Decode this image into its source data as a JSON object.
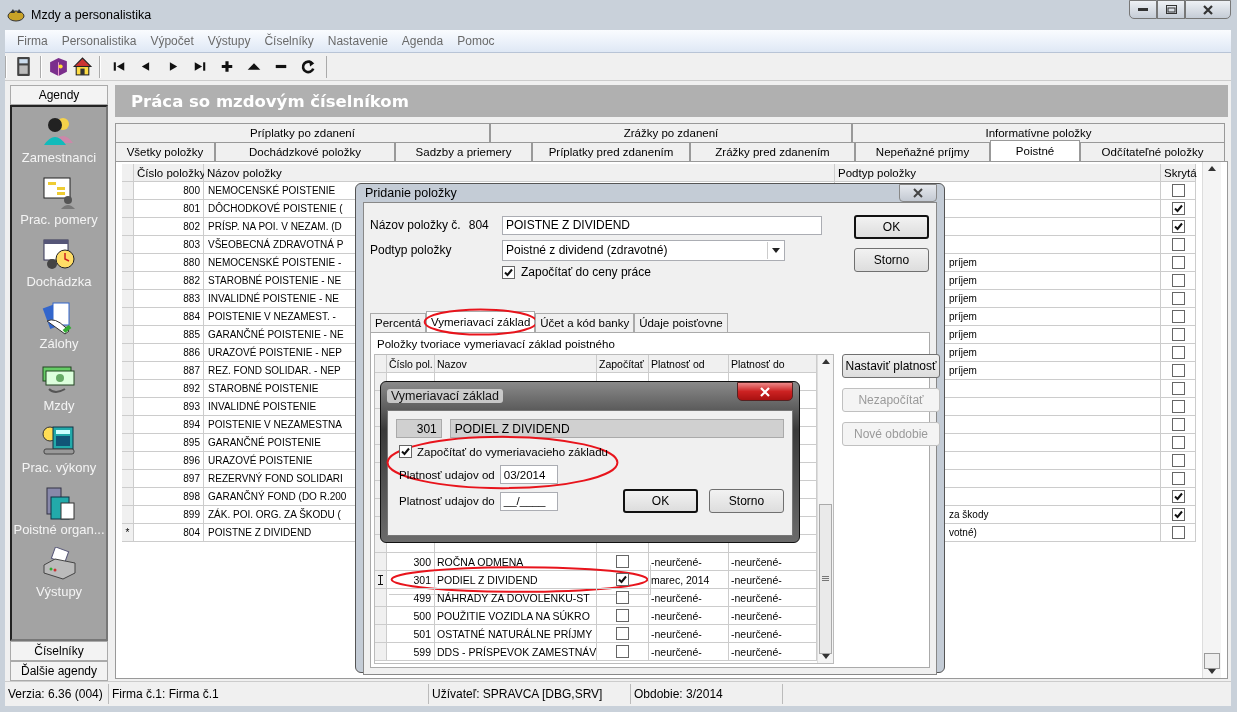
{
  "window": {
    "title": "Mzdy a personalistika"
  },
  "menu": [
    "Firma",
    "Personalistika",
    "Výpočet",
    "Výstupy",
    "Číselníky",
    "Nastavenie",
    "Agenda",
    "Pomoc"
  ],
  "sidebar": {
    "header": "Agendy",
    "items": [
      {
        "label": "Zamestnanci"
      },
      {
        "label": "Prac. pomery"
      },
      {
        "label": "Dochádzka"
      },
      {
        "label": "Zálohy"
      },
      {
        "label": "Mzdy"
      },
      {
        "label": "Prac. výkony"
      },
      {
        "label": "Poistné organ..."
      },
      {
        "label": "Výstupy"
      }
    ],
    "footer_buttons": [
      "Číselníky",
      "Ďalšie agendy"
    ]
  },
  "page_title": "Práca so mzdovým číselníkom",
  "tabs": {
    "row_1": [
      {
        "label": "Príplatky po zdanení",
        "selected": false
      },
      {
        "label": "Zrážky po zdanení",
        "selected": false
      },
      {
        "label": "Informatívne položky",
        "selected": false
      }
    ],
    "row_2": [
      {
        "label": "Všetky položky",
        "selected": false
      },
      {
        "label": "Dochádzkové položky",
        "selected": false
      },
      {
        "label": "Sadzby a priemery",
        "selected": false
      },
      {
        "label": "Príplatky pred zdanením",
        "selected": false
      },
      {
        "label": "Zrážky pred zdanením",
        "selected": false
      },
      {
        "label": "Nepeňažné príjmy",
        "selected": false
      },
      {
        "label": "Poistné",
        "selected": true
      },
      {
        "label": "Odčítateľné položky",
        "selected": false
      }
    ]
  },
  "table": {
    "columns": [
      "Číslo položky",
      "Názov položky",
      "Podtyp položky",
      "Skrytá"
    ],
    "rows": [
      {
        "number": "800",
        "name": "NEMOCENSKÉ POISTENIE",
        "hidden": false
      },
      {
        "number": "801",
        "name": "DÔCHODKOVÉ POISTENIE (",
        "hidden": true
      },
      {
        "number": "802",
        "name": "PRÍSP. NA POI. V NEZAM. (D",
        "hidden": true
      },
      {
        "number": "803",
        "name": "VŠEOBECNÁ ZDRAVOTNÁ P",
        "hidden": false
      },
      {
        "number": "880",
        "name": "NEMOCENSKÉ POISTENIE -",
        "subtype": "príjem",
        "hidden": false
      },
      {
        "number": "882",
        "name": "STAROBNÉ POISTENIE - NE",
        "subtype": "príjem",
        "hidden": false
      },
      {
        "number": "883",
        "name": "INVALIDNÉ POISTENIE - NE",
        "subtype": "príjem",
        "hidden": false
      },
      {
        "number": "884",
        "name": "POISTENIE V NEZAMEST. -",
        "subtype": "príjem",
        "hidden": false
      },
      {
        "number": "885",
        "name": "GARANČNÉ POISTENIE - NE",
        "subtype": "príjem",
        "hidden": false
      },
      {
        "number": "886",
        "name": "URAZOVÉ POISTENIE - NEP",
        "subtype": "príjem",
        "hidden": false
      },
      {
        "number": "887",
        "name": "REZ. FOND SOLIDAR. - NEP",
        "subtype": "príjem",
        "hidden": false
      },
      {
        "number": "892",
        "name": "STAROBNÉ POISTENIE",
        "hidden": false
      },
      {
        "number": "893",
        "name": "INVALIDNÉ POISTENIE",
        "hidden": false
      },
      {
        "number": "894",
        "name": "POISTENIE V NEZAMESTNA",
        "hidden": false
      },
      {
        "number": "895",
        "name": "GARANČNÉ POISTENIE",
        "hidden": false
      },
      {
        "number": "896",
        "name": "URAZOVÉ POISTENIE",
        "hidden": false
      },
      {
        "number": "897",
        "name": "REZERVNÝ FOND SOLIDARI",
        "hidden": false
      },
      {
        "number": "898",
        "name": "GARANČNÝ FOND (DO R.200",
        "hidden": true
      },
      {
        "number": "899",
        "name": "ZÁK. POI. ORG. ZA ŠKODU (",
        "subtype": "za škody",
        "hidden": true
      },
      {
        "marker": "*",
        "number": "804",
        "name": "POISTNE Z DIVIDEND",
        "subtype": "votné)",
        "hidden": false
      }
    ]
  },
  "dialog": {
    "title": "Pridanie položky",
    "name_label": "Názov položky č.",
    "number": "804",
    "name_value": "POISTNE Z DIVIDEND",
    "subtype_label": "Podtyp položky",
    "subtype_value": "Poistné z dividend (zdravotné)",
    "labor_cost": {
      "label": "Započítať do ceny práce",
      "checked": true
    },
    "ok": "OK",
    "cancel": "Storno",
    "tabs": [
      {
        "label": "Percentá",
        "selected": false,
        "highlighted": false
      },
      {
        "label": "Vymeriavací základ",
        "selected": true,
        "highlighted": true
      },
      {
        "label": "Účet a kód banky",
        "selected": false,
        "highlighted": false
      },
      {
        "label": "Údaje poisťovne",
        "selected": false,
        "highlighted": false
      }
    ],
    "panel_caption": "Položky tvoriace vymeriavací základ poistného",
    "grid": {
      "columns": [
        "Číslo pol.",
        "Nazov",
        "Započítať",
        "Platnosť od",
        "Platnosť do"
      ],
      "rows": [
        {
          "number": "300",
          "name": "ROČNA ODMENA",
          "included": false,
          "from": "-neurčené-",
          "to": "-neurčené-",
          "current": false,
          "highlighted": false
        },
        {
          "number": "301",
          "name": "PODIEL Z DIVIDEND",
          "included": true,
          "from": "marec, 2014",
          "to": "-neurčené-",
          "current": true,
          "highlighted": true
        },
        {
          "number": "499",
          "name": "NÁHRADY ZA DOVOLENKU-ST",
          "included": false,
          "from": "-neurčené-",
          "to": "-neurčené-",
          "current": false,
          "highlighted": false
        },
        {
          "number": "500",
          "name": "POUŽITIE VOZIDLA NA SÚKRO",
          "included": false,
          "from": "-neurčené-",
          "to": "-neurčené-",
          "current": false,
          "highlighted": false
        },
        {
          "number": "501",
          "name": "OSTATNÉ NATURÁLNE PRÍJMY",
          "included": false,
          "from": "-neurčené-",
          "to": "-neurčené-",
          "current": false,
          "highlighted": false
        },
        {
          "number": "599",
          "name": "DDS - PRÍSPEVOK ZAMESTNÁV",
          "included": false,
          "from": "-neurčené-",
          "to": "-neurčené-",
          "current": false,
          "highlighted": false
        }
      ]
    },
    "side_buttons": [
      {
        "label": "Nastaviť platnosť",
        "disabled": false
      },
      {
        "label": "Nezapočítať",
        "disabled": true
      },
      {
        "label": "Nové obdobie",
        "disabled": true
      }
    ]
  },
  "subdialog": {
    "title": "Vymeriavací základ",
    "number": "301",
    "name": "PODIEL Z DIVIDEND",
    "include": {
      "label": "Započítať do vymeriavacieho základu",
      "checked": true
    },
    "from_label": "Platnosť udajov od",
    "from_value": "03/2014",
    "to_label": "Platnosť udajov do",
    "to_value": "__/____",
    "highlighted": true,
    "ok": "OK",
    "cancel": "Storno"
  },
  "status_bar": [
    "Verzia: 6.36 (004)",
    "Firma č.1: Firma č.1",
    "Užívateľ: SPRAVCA [DBG,SRV]",
    "Obdobie: 3/2014"
  ]
}
